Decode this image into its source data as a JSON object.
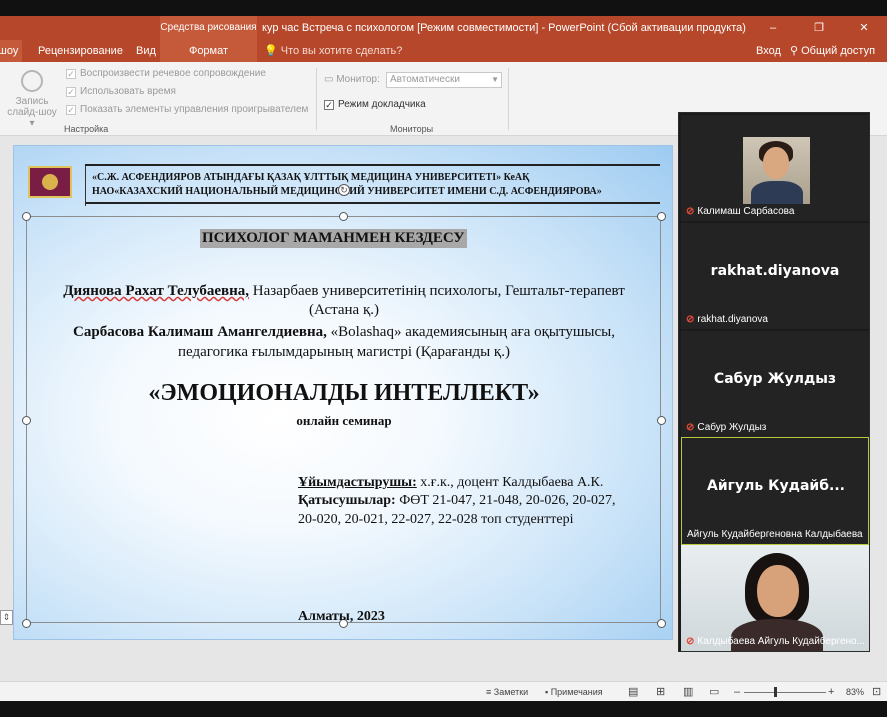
{
  "app": {
    "context_tab": "Средства рисования",
    "title": "кур час Встреча с психологом [Режим совместимости] - PowerPoint (Сбой активации продукта)",
    "window_controls": [
      "–",
      "❐",
      "✕"
    ]
  },
  "tabs": {
    "items": [
      "шоу",
      "Рецензирование",
      "Вид",
      "Формат"
    ],
    "tell_me": "Что вы хотите сделать?",
    "signin": "Вход",
    "share": "Общий доступ"
  },
  "ribbon": {
    "record_label_1": "Запись",
    "record_label_2": "слайд-шоу ▾",
    "checks": [
      {
        "label": "Воспроизвести речевое сопровождение",
        "checked": true,
        "enabled": false
      },
      {
        "label": "Использовать время",
        "checked": true,
        "enabled": false
      },
      {
        "label": "Показать элементы управления проигрывателем",
        "checked": true,
        "enabled": false
      }
    ],
    "group_setup": "Настройка",
    "monitor_label": "Монитор:",
    "monitor_value": "Автоматически",
    "presenter_view": "Режим докладчика",
    "group_monitors": "Мониторы"
  },
  "slide": {
    "header_line1": "«С.Ж. АСФЕНДИЯРОВ АТЫНДАҒЫ ҚАЗАҚ ҰЛТТЫҚ МЕДИЦИНА УНИВЕРСИТЕТІ» КеАҚ",
    "header_line2": "НАО«КАЗАХСКИЙ НАЦИОНАЛЬНЫЙ МЕДИЦИНСКИЙ УНИВЕРСИТЕТ ИМЕНИ С.Д. АСФЕНДИЯРОВА»",
    "heading": "ПСИХОЛОГ МАМАНМЕН КЕЗДЕСУ",
    "speaker1_name": "Диянова Рахат Телубаевна,",
    "speaker1_role": " Назарбаев университетінің психологы, Гештальт-терапевт",
    "speaker1_city": "(Астана қ.)",
    "speaker2_name": "Сарбасова Калимаш Амангелдиевна,",
    "speaker2_role": "  «Bolashaq» академиясының  аға оқытушысы,",
    "speaker2_degree": "педагогика ғылымдарының магистрі (Қарағанды қ.)",
    "title": "«ЭМОЦИОНАЛДЫ ИНТЕЛЛЕКТ»",
    "subtitle": "онлайн семинар",
    "organizer_label": "Ұйымдастырушы:",
    "organizer_value": "  х.ғ.к., доцент Калдыбаева А.К.",
    "participants_label": "Қатысушылар:",
    "participants_value": "  ФӨТ  21-047,  21-048,  20-026,  20-027,",
    "participants_value2": "20-020, 20-021, 22-027, 22-028 топ студенттері",
    "city_year": "Алматы, 2023"
  },
  "participants": [
    {
      "name": "Калимаш Сарбасова",
      "display": "",
      "muted": true,
      "video": true
    },
    {
      "name": "rakhat.diyanova",
      "display": "rakhat.diyanova",
      "muted": true,
      "video": false
    },
    {
      "name": "Сабур Жулдыз",
      "display": "Сабур Жулдыз",
      "muted": true,
      "video": false
    },
    {
      "name": "Айгуль Кудайбергеновна Калдыбаева",
      "display": "Айгуль  Кудайб...",
      "muted": false,
      "video": false,
      "speaking": true
    },
    {
      "name": "Калдыбаева Айгуль Кудайбергенo...",
      "display": "",
      "muted": true,
      "video": true
    }
  ],
  "status": {
    "notes": "Заметки",
    "comments": "Примечания",
    "zoom": "83%",
    "zoom_minus": "–",
    "zoom_plus": "+"
  },
  "colors": {
    "accent": "#b7472a",
    "speaking_border": "#b9c93a",
    "muted_icon": "#e24a3a"
  }
}
